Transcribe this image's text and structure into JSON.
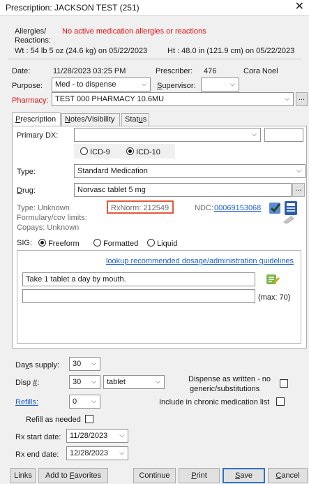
{
  "window": {
    "title": "Prescription: JACKSON TEST (251)"
  },
  "patient": {
    "allergies_label": "Allergies/",
    "reactions_label": "Reactions:",
    "allergies_value": "No active medication allergies or reactions",
    "weight": "Wt : 54 lb 5 oz (24.6 kg) on 05/22/2023",
    "height": "Ht : 48.0 in (121.9 cm) on 05/22/2023"
  },
  "header": {
    "date_label": "Date:",
    "date_value": "11/28/2023 03:25 PM",
    "prescriber_label": "Prescriber:",
    "prescriber_id": "476",
    "prescriber_name": "Cora Noel",
    "purpose_label": "Purpose:",
    "purpose_value": "Med - to dispense",
    "supervisor_label": "Supervisor:",
    "supervisor_value": "",
    "pharmacy_label": "Pharmacy:",
    "pharmacy_value": "TEST 000 PHARMACY 10.6MU",
    "pharmacy_more": "..."
  },
  "tabs": [
    {
      "label": "Prescription",
      "selected": true
    },
    {
      "label": "Notes/Visibility",
      "selected": false
    },
    {
      "label": "Status",
      "selected": false
    }
  ],
  "rx": {
    "primary_dx_label": "Primary DX:",
    "primary_dx_value": "",
    "primary_dx_code": "",
    "icd9_label": "ICD-9",
    "icd10_label": "ICD-10",
    "icd_selected": "ICD-10",
    "type_label": "Type:",
    "type_value": "Standard Medication",
    "drug_label": "Drug:",
    "drug_value": "Norvasc tablet 5 mg",
    "drug_more": "...",
    "type_info": "Type:  Unknown",
    "rxnorm": "RxNorm: 212549",
    "ndc_label": "NDC:",
    "ndc_value": "00069153068",
    "formulary": "Formulary/cov limits:",
    "copays": "Copays:  Unknown",
    "sig_label": "SIG:",
    "sig_options": [
      "Freeform",
      "Formatted",
      "Liquid"
    ],
    "sig_selected": "Freeform",
    "lookup_link": "lookup recommended dosage/administration guidelines",
    "sig_text": "Take 1 tablet a day by  mouth.",
    "sig_text2": "",
    "max_label": "(max: 70)"
  },
  "supply": {
    "days_label": "Days supply:",
    "days_value": "30",
    "disp_label": "Disp #:",
    "disp_value": "30",
    "disp_unit": "tablet",
    "daw_label_1": "Dispense as written - no",
    "daw_label_2": "generic/substitutions",
    "refills_label": "Refills:",
    "refills_value": "0",
    "chronic_label": "Include in chronic medication list",
    "refill_needed_label": "Refill as needed",
    "start_label": "Rx start date:",
    "start_value": "11/28/2023",
    "end_label": "Rx end date:",
    "end_value": "12/28/2023"
  },
  "footer": {
    "links": "Links",
    "favorites": "Add to Favorites",
    "continue": "Continue",
    "print": "Print",
    "save": "Save",
    "cancel": "Cancel"
  }
}
